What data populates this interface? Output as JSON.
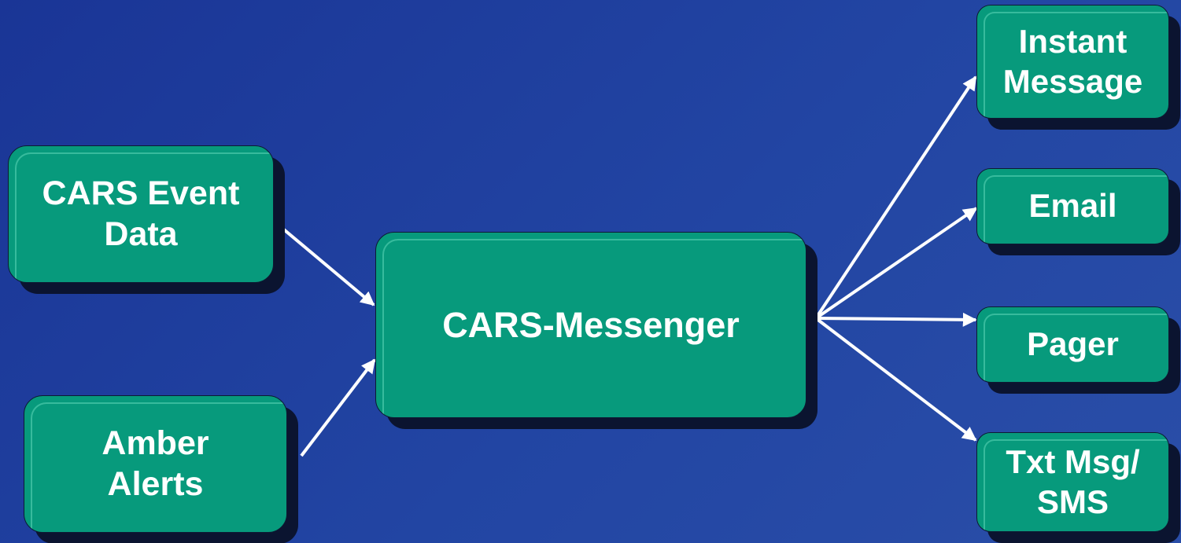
{
  "diagram": {
    "nodes": {
      "cars_event": "CARS Event\nData",
      "amber": "Amber\nAlerts",
      "messenger": "CARS-Messenger",
      "instant": "Instant\nMessage",
      "email": "Email",
      "pager": "Pager",
      "txt": "Txt Msg/\nSMS"
    },
    "edges": [
      {
        "from": "CARS Event Data",
        "to": "CARS-Messenger"
      },
      {
        "from": "Amber Alerts",
        "to": "CARS-Messenger"
      },
      {
        "from": "CARS-Messenger",
        "to": "Instant Message"
      },
      {
        "from": "CARS-Messenger",
        "to": "Email"
      },
      {
        "from": "CARS-Messenger",
        "to": "Pager"
      },
      {
        "from": "CARS-Messenger",
        "to": "Txt Msg/SMS"
      }
    ]
  },
  "colors": {
    "background": "#2245a3",
    "box_fill": "#079a7c",
    "box_shadow": "#0b1430",
    "arrow": "#ffffff",
    "text": "#ffffff"
  }
}
